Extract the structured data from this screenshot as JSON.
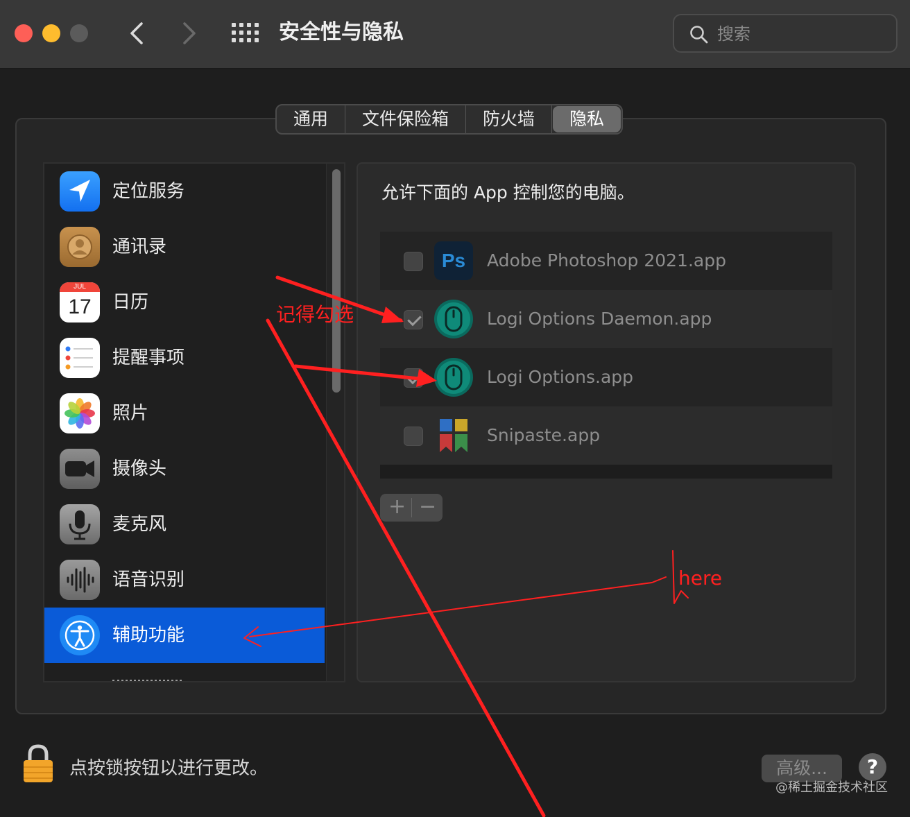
{
  "window": {
    "title": "安全性与隐私",
    "search_placeholder": "搜索"
  },
  "tabs": [
    {
      "label": "通用",
      "active": false
    },
    {
      "label": "文件保险箱",
      "active": false
    },
    {
      "label": "防火墙",
      "active": false
    },
    {
      "label": "隐私",
      "active": true
    }
  ],
  "sidebar": {
    "items": [
      {
        "label": "定位服务",
        "icon": "location-arrow-icon"
      },
      {
        "label": "通讯录",
        "icon": "contacts-icon"
      },
      {
        "label": "日历",
        "icon": "calendar-icon",
        "calendar_month": "JUL",
        "calendar_day": "17"
      },
      {
        "label": "提醒事项",
        "icon": "reminders-icon"
      },
      {
        "label": "照片",
        "icon": "photos-icon"
      },
      {
        "label": "摄像头",
        "icon": "camera-icon"
      },
      {
        "label": "麦克风",
        "icon": "microphone-icon"
      },
      {
        "label": "语音识别",
        "icon": "speech-recognition-icon"
      },
      {
        "label": "辅助功能",
        "icon": "accessibility-icon",
        "selected": true
      }
    ]
  },
  "pane": {
    "heading": "允许下面的 App 控制您的电脑。",
    "apps": [
      {
        "name": "Adobe Photoshop 2021.app",
        "checked": false,
        "icon": "photoshop-icon",
        "icon_text": "Ps"
      },
      {
        "name": "Logi Options Daemon.app",
        "checked": true,
        "icon": "logi-mouse-icon"
      },
      {
        "name": "Logi Options.app",
        "checked": true,
        "icon": "logi-mouse-icon"
      },
      {
        "name": "Snipaste.app",
        "checked": false,
        "icon": "snipaste-icon"
      }
    ],
    "add_label": "+",
    "remove_label": "−"
  },
  "footer": {
    "lock_text": "点按锁按钮以进行更改。",
    "advanced_label": "高级...",
    "help_label": "?",
    "watermark": "@稀土掘金技术社区"
  },
  "annotations": {
    "note_1": "记得勾选",
    "note_2": "here",
    "color": "#ff2020"
  },
  "colors": {
    "selection_blue": "#0a5bd8",
    "close": "#fe5f57",
    "minimize": "#febc2e"
  }
}
